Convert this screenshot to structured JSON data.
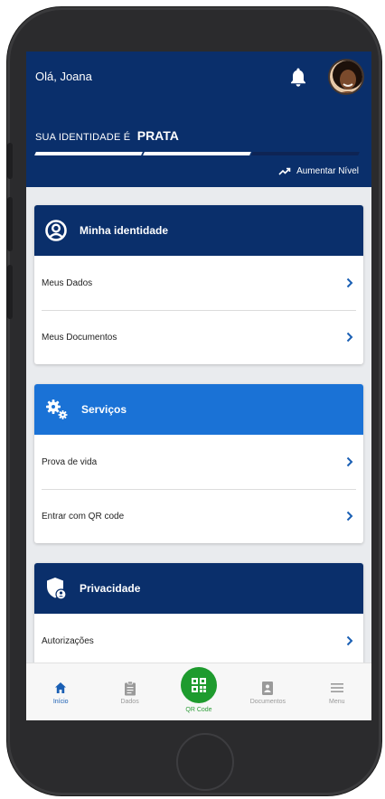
{
  "header": {
    "greeting": "Olá, Joana"
  },
  "identity_level": {
    "label": "SUA IDENTIDADE É",
    "value": "PRATA",
    "progress_segments_filled": 2,
    "progress_segments_total": 3,
    "upgrade_label": "Aumentar Nível"
  },
  "cards": [
    {
      "title": "Minha identidade",
      "icon": "user-circle-icon",
      "color": "#0a2f6b",
      "items": [
        "Meus Dados",
        "Meus Documentos"
      ]
    },
    {
      "title": "Serviços",
      "icon": "gears-icon",
      "color": "#1a72d6",
      "items": [
        "Prova de vida",
        "Entrar com QR code"
      ]
    },
    {
      "title": "Privacidade",
      "icon": "shield-user-icon",
      "color": "#0a2f6b",
      "items": [
        "Autorizações"
      ]
    }
  ],
  "bottom_nav": {
    "inicio": "Início",
    "dados": "Dados",
    "qr": "QR Code",
    "documentos": "Documentos",
    "menu": "Menu"
  },
  "colors": {
    "primary": "#0a2f6b",
    "accent": "#1a72d6",
    "qr_green": "#1e9b2e",
    "active_nav": "#1a5fb4"
  }
}
